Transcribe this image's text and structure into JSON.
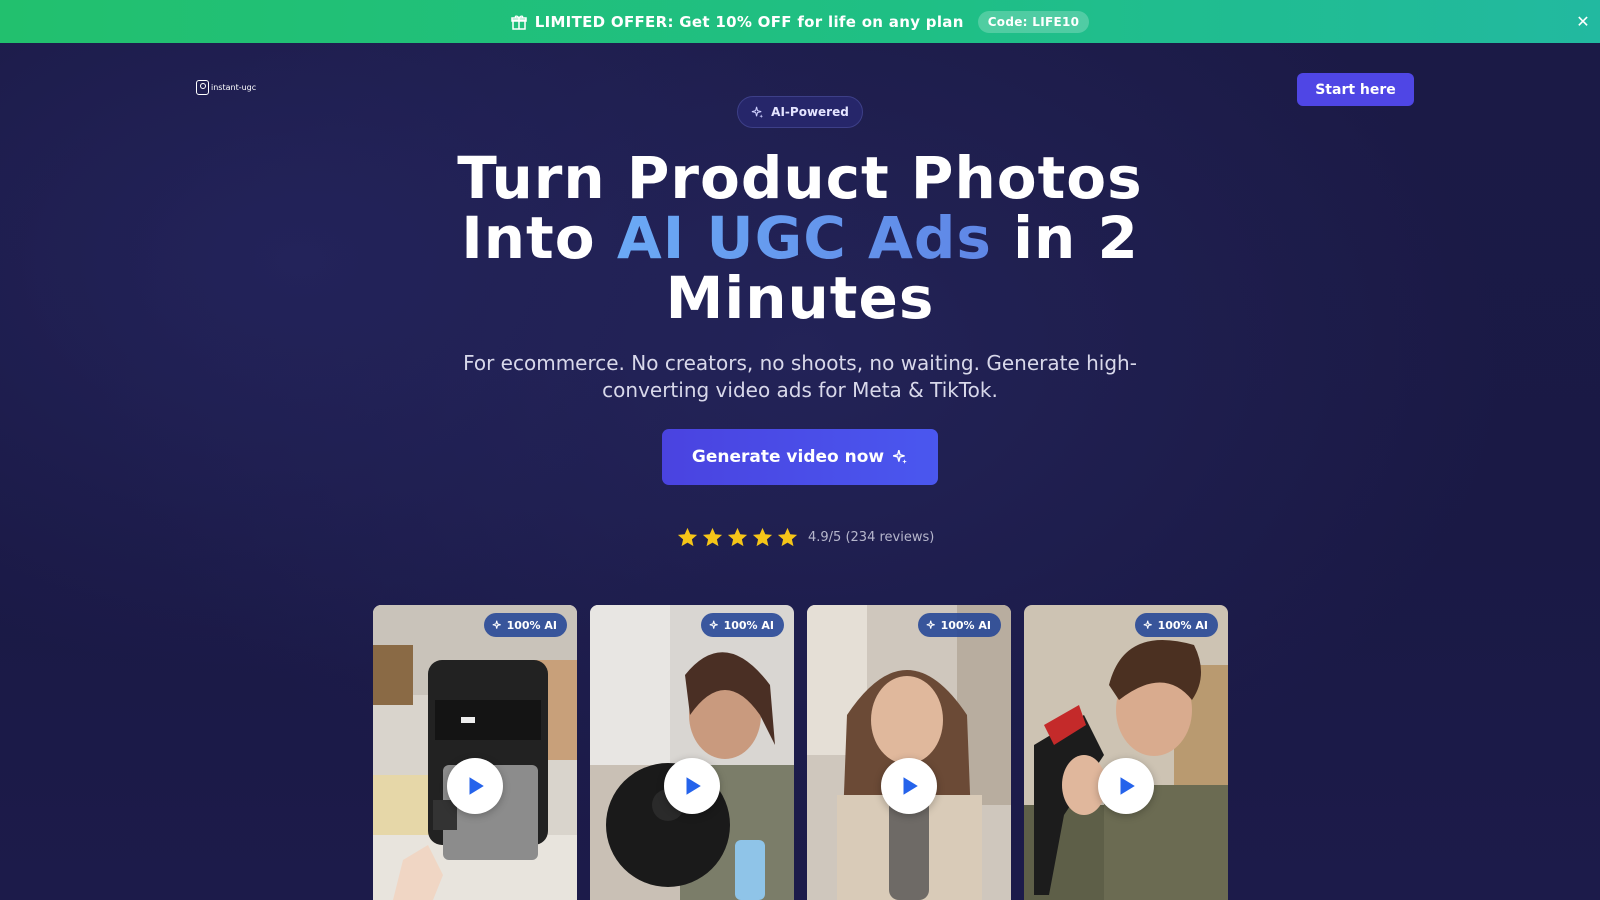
{
  "banner": {
    "icon": "gift-icon",
    "text": "LIMITED OFFER: Get 10% OFF for life on any plan",
    "code": "Code: LIFE10",
    "close_label": "✕"
  },
  "header": {
    "logo_text": "instant-ugc",
    "start_button": "Start here"
  },
  "hero": {
    "pill_label": "AI-Powered",
    "title_part1": "Turn Product Photos Into ",
    "title_highlight": "AI UGC Ads",
    "title_part2": " in 2 Minutes",
    "subtitle": "For ecommerce. No creators, no shoots, no waiting. Generate high-converting video ads for Meta & TikTok.",
    "cta_label": "Generate video now",
    "rating_value": 4.9,
    "rating_text": "4.9/5 (234 reviews)",
    "stars": 5
  },
  "videos": [
    {
      "badge": "100% AI",
      "subject": "air-fryer"
    },
    {
      "badge": "100% AI",
      "subject": "robot-vacuum"
    },
    {
      "badge": "100% AI",
      "subject": "water-bottle"
    },
    {
      "badge": "100% AI",
      "subject": "hair-dryer"
    }
  ],
  "colors": {
    "banner_green": "#22c06e",
    "accent_indigo": "#4f46e5",
    "highlight_blue": "#6ba9f5",
    "star_gold": "#f5c518",
    "background": "#1b1a46"
  }
}
